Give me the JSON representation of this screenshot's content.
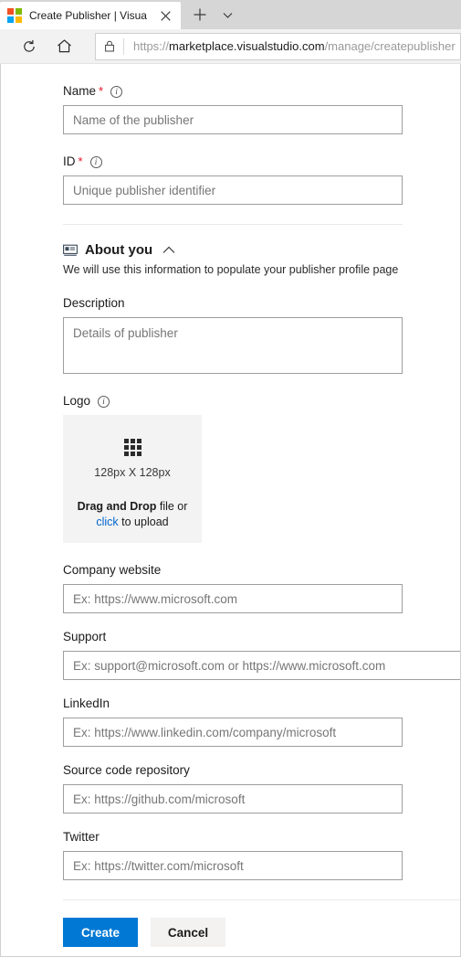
{
  "browser": {
    "tab": {
      "title": "Create Publisher | Visua",
      "favicon": "microsoft-logo",
      "close_label": "✕"
    },
    "new_tab_label": "+",
    "tab_list_label": "⌄",
    "toolbar": {
      "refresh_label": "refresh-icon",
      "home_label": "home-icon",
      "lock_label": "lock-icon"
    },
    "address_bar": {
      "url_scheme": "https://",
      "url_domain": "marketplace.visualstudio.com",
      "url_path": "/manage/createpublisher"
    }
  },
  "form": {
    "name": {
      "label": "Name",
      "required_marker": "*",
      "placeholder": "Name of the publisher",
      "value": ""
    },
    "id": {
      "label": "ID",
      "required_marker": "*",
      "placeholder": "Unique publisher identifier",
      "value": ""
    },
    "about_section": {
      "title": "About you",
      "subtitle": "We will use this information to populate your publisher profile page",
      "icon": "contact-card-icon",
      "collapse_icon": "chevron-up-icon"
    },
    "description": {
      "label": "Description",
      "placeholder": "Details of publisher",
      "value": ""
    },
    "logo": {
      "label": "Logo",
      "dimensions": "128px X 128px",
      "drag_text_bold": "Drag and Drop",
      "drag_text_rest": " file or",
      "click_link": "click",
      "click_rest": " to upload"
    },
    "company_website": {
      "label": "Company website",
      "placeholder": "Ex: https://www.microsoft.com",
      "value": ""
    },
    "support": {
      "label": "Support",
      "placeholder": "Ex: support@microsoft.com or https://www.microsoft.com",
      "value": ""
    },
    "linkedin": {
      "label": "LinkedIn",
      "placeholder": "Ex: https://www.linkedin.com/company/microsoft",
      "value": ""
    },
    "source_code": {
      "label": "Source code repository",
      "placeholder": "Ex: https://github.com/microsoft",
      "value": ""
    },
    "twitter": {
      "label": "Twitter",
      "placeholder": "Ex: https://twitter.com/microsoft",
      "value": ""
    },
    "actions": {
      "create_label": "Create",
      "cancel_label": "Cancel"
    }
  },
  "colors": {
    "primary": "#0078d4",
    "required": "#e81123",
    "link": "#0066cc",
    "dropzone_bg": "#f3f3f3"
  }
}
